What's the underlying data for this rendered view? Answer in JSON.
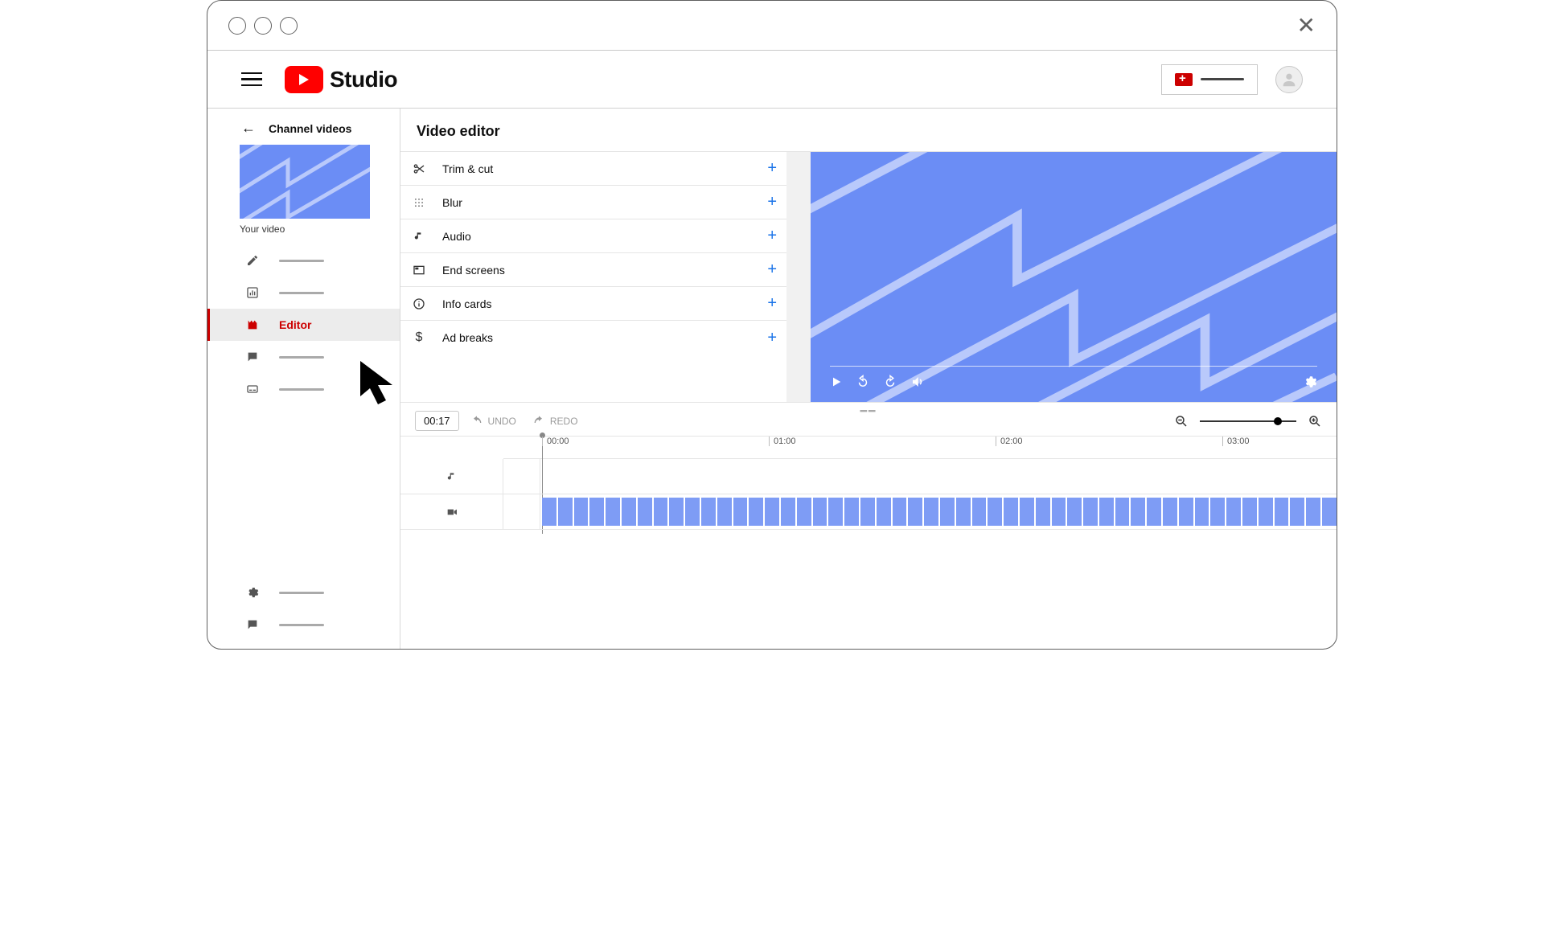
{
  "brand": {
    "name": "Studio"
  },
  "sidebar": {
    "back_label": "Channel videos",
    "thumb_label": "Your video",
    "items": [
      {
        "id": "details",
        "icon": "pencil"
      },
      {
        "id": "analytics",
        "icon": "bars"
      },
      {
        "id": "editor",
        "icon": "clapper",
        "label": "Editor",
        "active": true
      },
      {
        "id": "comments",
        "icon": "comment"
      },
      {
        "id": "subtitles",
        "icon": "cc"
      }
    ],
    "bottom": [
      {
        "id": "settings",
        "icon": "gear"
      },
      {
        "id": "feedback",
        "icon": "feedback"
      }
    ]
  },
  "page": {
    "title": "Video editor"
  },
  "tools": {
    "items": [
      {
        "id": "trim",
        "label": "Trim & cut",
        "icon": "scissors"
      },
      {
        "id": "blur",
        "label": "Blur",
        "icon": "grid"
      },
      {
        "id": "audio",
        "label": "Audio",
        "icon": "note"
      },
      {
        "id": "ends",
        "label": "End screens",
        "icon": "endscreen"
      },
      {
        "id": "info",
        "label": "Info cards",
        "icon": "info"
      },
      {
        "id": "ad",
        "label": "Ad breaks",
        "icon": "dollar"
      }
    ]
  },
  "timeline": {
    "current": "00:17",
    "undo_label": "UNDO",
    "redo_label": "REDO",
    "marks": [
      "00:00",
      "01:00",
      "02:00",
      "03:00"
    ]
  },
  "colors": {
    "brand_red": "#ff0000",
    "link_blue": "#1a73e8",
    "clip_blue": "#7e9cf5",
    "preview_blue": "#6b8df5"
  }
}
